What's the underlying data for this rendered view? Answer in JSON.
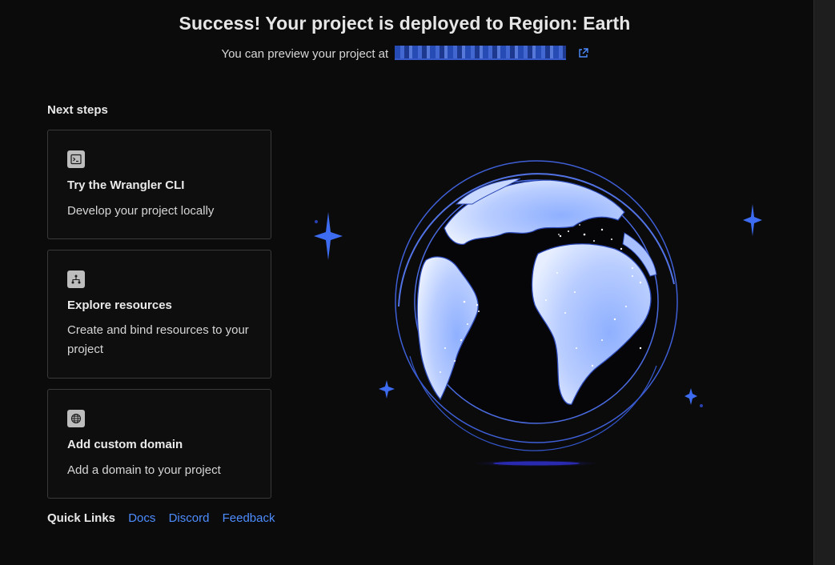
{
  "header": {
    "title": "Success! Your project is deployed to Region: Earth",
    "subtitle": "You can preview your project at"
  },
  "next_steps": {
    "heading": "Next steps",
    "cards": [
      {
        "icon": "terminal-icon",
        "title": "Try the Wrangler CLI",
        "description": "Develop your project locally"
      },
      {
        "icon": "resources-icon",
        "title": "Explore resources",
        "description": "Create and bind resources to your project"
      },
      {
        "icon": "globe-icon",
        "title": "Add custom domain",
        "description": "Add a domain to your project"
      }
    ]
  },
  "quick_links": {
    "label": "Quick Links",
    "links": [
      "Docs",
      "Discord",
      "Feedback"
    ]
  },
  "colors": {
    "background": "#0b0b0b",
    "accent": "#4d8dff",
    "card_border": "#3a3a3a",
    "globe_blue": "#7fa2ff"
  },
  "illustration": {
    "icon": "earth-globe-illustration"
  }
}
